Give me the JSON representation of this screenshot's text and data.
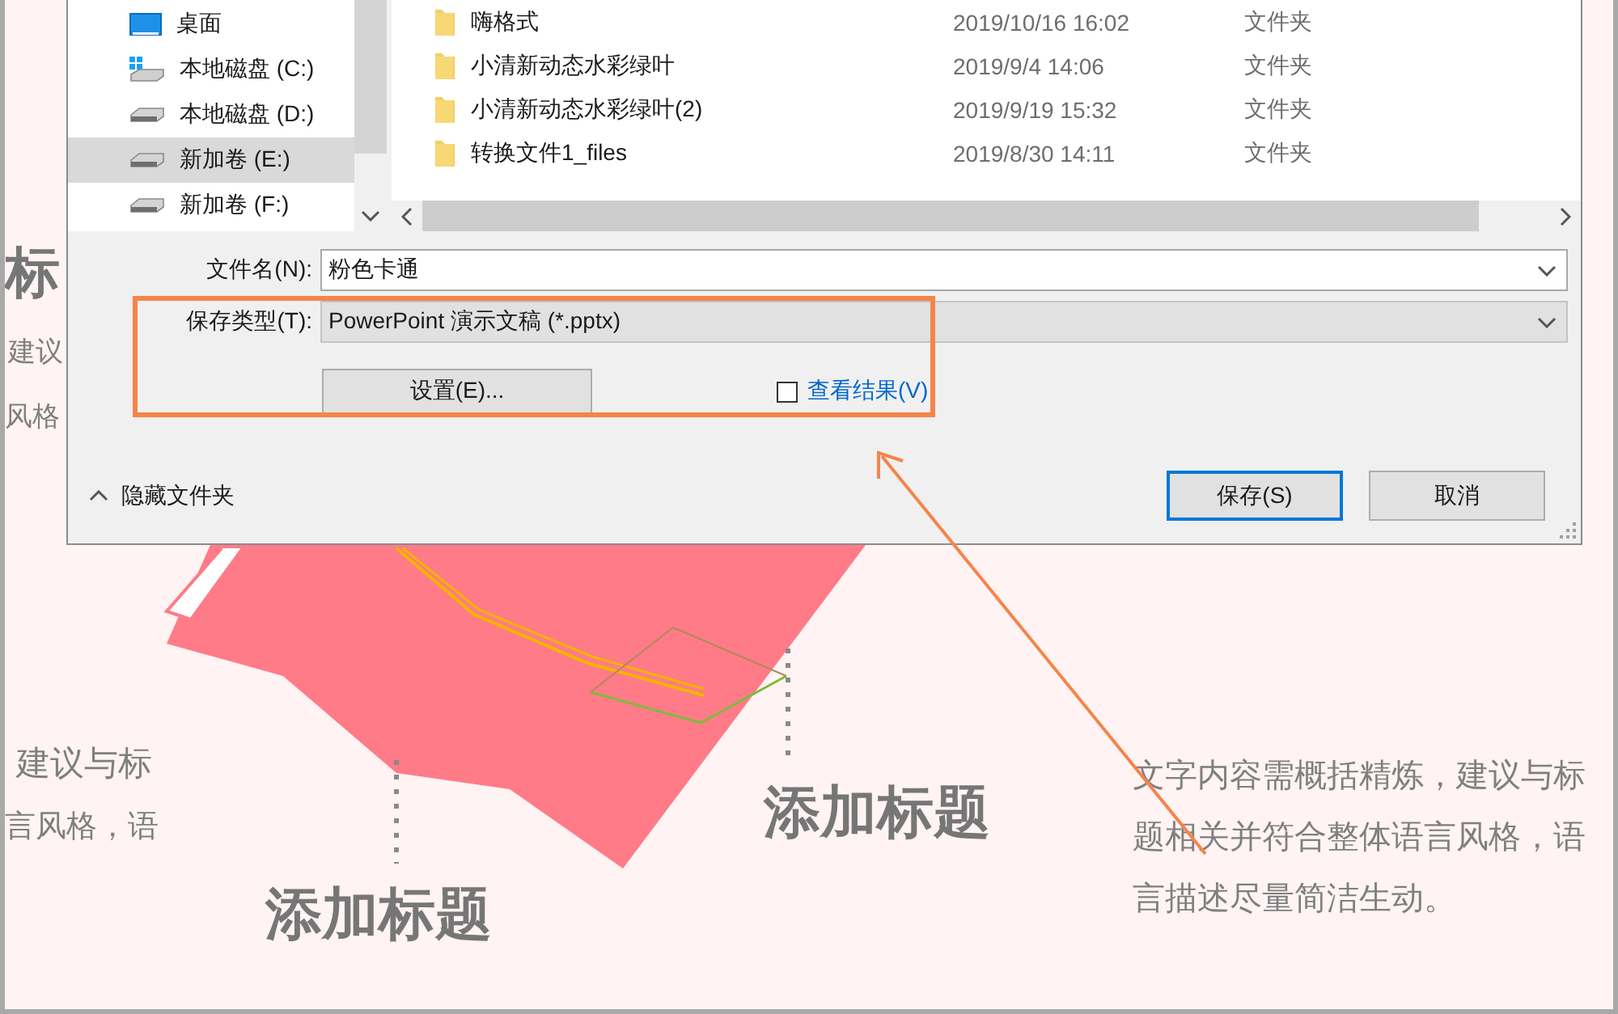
{
  "slide": {
    "texts": [
      {
        "kind": "heading",
        "text": "标"
      },
      {
        "kind": "body",
        "text": "建议"
      },
      {
        "kind": "body",
        "text": "风格"
      },
      {
        "kind": "body",
        "text": "建议与标"
      },
      {
        "kind": "body",
        "text": "言风格，语"
      },
      {
        "kind": "heading",
        "text": "添加标题"
      },
      {
        "kind": "heading",
        "text": "添加标题"
      },
      {
        "kind": "body",
        "text": "文字内容需概括精炼，建议与标题相关并符合整体语言风格，语言描述尽量简洁生动。"
      }
    ]
  },
  "dialog": {
    "nav_items": [
      {
        "label": "桌面",
        "kind": "desktop",
        "selected": false
      },
      {
        "label": "本地磁盘 (C:)",
        "kind": "system-drive",
        "selected": false
      },
      {
        "label": "本地磁盘 (D:)",
        "kind": "drive",
        "selected": false
      },
      {
        "label": "新加卷 (E:)",
        "kind": "drive",
        "selected": true
      },
      {
        "label": "新加卷 (F:)",
        "kind": "drive",
        "selected": false
      }
    ],
    "files": [
      {
        "name": "嗨格式",
        "date": "2019/10/16 16:02",
        "type": "文件夹"
      },
      {
        "name": "小清新动态水彩绿叶",
        "date": "2019/9/4 14:06",
        "type": "文件夹"
      },
      {
        "name": "小清新动态水彩绿叶(2)",
        "date": "2019/9/19 15:32",
        "type": "文件夹"
      },
      {
        "name": "转换文件1_files",
        "date": "2019/8/30 14:11",
        "type": "文件夹"
      }
    ],
    "file_name": {
      "label": "文件名(N):",
      "value": "粉色卡通"
    },
    "save_type": {
      "label": "保存类型(T):",
      "value": "PowerPoint 演示文稿 (*.pptx)"
    },
    "tools_button": "设置(E)...",
    "view_result": {
      "label": "查看结果(V)",
      "checked": false
    },
    "hide_folders": "隐藏文件夹",
    "buttons": [
      {
        "label": "保存(S)",
        "default": true
      },
      {
        "label": "取消",
        "default": false
      }
    ]
  }
}
